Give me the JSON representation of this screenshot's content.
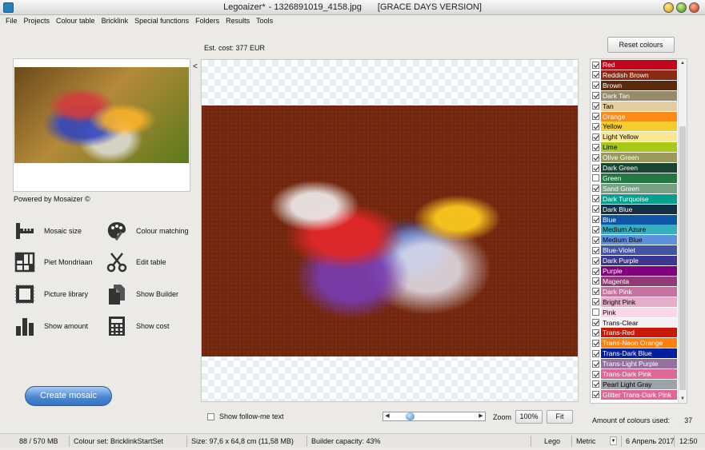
{
  "window": {
    "app_name": "Legoaizer*",
    "file_name": "- 1326891019_4158.jpg",
    "edition": "[GRACE DAYS VERSION]"
  },
  "menu": [
    "File",
    "Projects",
    "Colour table",
    "Bricklink",
    "Special functions",
    "Folders",
    "Results",
    "Tools"
  ],
  "left_panel": {
    "powered_by": "Powered by Mosaizer ©",
    "collapse_glyph": "<",
    "tools": [
      {
        "label": "Mosaic size",
        "icon": "ruler-icon"
      },
      {
        "label": "Colour matching",
        "icon": "palette-icon"
      },
      {
        "label": "Piet Mondriaan",
        "icon": "grid-icon"
      },
      {
        "label": "Edit table",
        "icon": "scissors-icon"
      },
      {
        "label": "Picture library",
        "icon": "picture-frame-icon"
      },
      {
        "label": "Show Builder",
        "icon": "documents-icon"
      },
      {
        "label": "Show amount",
        "icon": "bar-chart-icon"
      },
      {
        "label": "Show cost",
        "icon": "calculator-icon"
      }
    ],
    "create_button": "Create mosaic"
  },
  "center": {
    "est_cost": "Est. cost: 377 EUR",
    "follow_me_label": "Show follow-me text",
    "zoom_label": "Zoom",
    "zoom_value": "100%",
    "fit_label": "Fit",
    "slider_position": 0.18
  },
  "right_panel": {
    "reset_button": "Reset colours",
    "amount_label": "Amount of colours used:",
    "amount_value": "37",
    "colors": [
      {
        "name": "Red",
        "hex": "#c0061b",
        "text": "#ffffff",
        "checked": true
      },
      {
        "name": "Reddish Brown",
        "hex": "#8a2a12",
        "text": "#ffffff",
        "checked": true
      },
      {
        "name": "Brown",
        "hex": "#5a2a0e",
        "text": "#ffffff",
        "checked": true
      },
      {
        "name": "Dark Tan",
        "hex": "#958a6a",
        "text": "#ffffff",
        "checked": true
      },
      {
        "name": "Tan",
        "hex": "#e4cd9e",
        "text": "#000000",
        "checked": true
      },
      {
        "name": "Orange",
        "hex": "#fe8a18",
        "text": "#ffffff",
        "checked": true
      },
      {
        "name": "Yellow",
        "hex": "#f5cd2f",
        "text": "#000000",
        "checked": true
      },
      {
        "name": "Light Yellow",
        "hex": "#fbe696",
        "text": "#000000",
        "checked": true
      },
      {
        "name": "Lime",
        "hex": "#a5ca18",
        "text": "#000000",
        "checked": true
      },
      {
        "name": "Olive Green",
        "hex": "#9b9a5a",
        "text": "#ffffff",
        "checked": true
      },
      {
        "name": "Dark Green",
        "hex": "#184632",
        "text": "#ffffff",
        "checked": true
      },
      {
        "name": "Green",
        "hex": "#237841",
        "text": "#ffffff",
        "checked": false
      },
      {
        "name": "Sand Green",
        "hex": "#78a083",
        "text": "#ffffff",
        "checked": true
      },
      {
        "name": "Dark Turquoise",
        "hex": "#069e8e",
        "text": "#ffffff",
        "checked": true
      },
      {
        "name": "Dark Blue",
        "hex": "#143044",
        "text": "#ffffff",
        "checked": true
      },
      {
        "name": "Blue",
        "hex": "#0d56a6",
        "text": "#ffffff",
        "checked": true
      },
      {
        "name": "Medium Azure",
        "hex": "#36aebf",
        "text": "#000000",
        "checked": true
      },
      {
        "name": "Medium Blue",
        "hex": "#5a93db",
        "text": "#000000",
        "checked": true
      },
      {
        "name": "Blue-Violet",
        "hex": "#4354a3",
        "text": "#ffffff",
        "checked": true
      },
      {
        "name": "Dark Purple",
        "hex": "#3f3691",
        "text": "#ffffff",
        "checked": true
      },
      {
        "name": "Purple",
        "hex": "#81007b",
        "text": "#ffffff",
        "checked": true
      },
      {
        "name": "Magenta",
        "hex": "#923978",
        "text": "#ffffff",
        "checked": true
      },
      {
        "name": "Dark Pink",
        "hex": "#c870a0",
        "text": "#ffffff",
        "checked": true
      },
      {
        "name": "Bright Pink",
        "hex": "#e4adc8",
        "text": "#000000",
        "checked": true
      },
      {
        "name": "Pink",
        "hex": "#fcd7e8",
        "text": "#000000",
        "checked": false
      },
      {
        "name": "Trans-Clear",
        "hex": "#f2f2f2",
        "text": "#000000",
        "checked": true
      },
      {
        "name": "Trans-Red",
        "hex": "#c91a09",
        "text": "#ffffff",
        "checked": true
      },
      {
        "name": "Trans-Neon Orange",
        "hex": "#ff800d",
        "text": "#ffffff",
        "checked": true
      },
      {
        "name": "Trans-Dark Blue",
        "hex": "#0020a0",
        "text": "#ffffff",
        "checked": true
      },
      {
        "name": "Trans-Light Purple",
        "hex": "#96709f",
        "text": "#ffffff",
        "checked": true
      },
      {
        "name": "Trans-Dark Pink",
        "hex": "#df6695",
        "text": "#ffffff",
        "checked": true
      },
      {
        "name": "Pearl Light Gray",
        "hex": "#9ca3a8",
        "text": "#000000",
        "checked": true
      },
      {
        "name": "Glitter Trans-Dark Pink",
        "hex": "#df6695",
        "text": "#ffffff",
        "checked": true
      }
    ]
  },
  "status": {
    "memory": "88 / 570 MB",
    "colour_set": "Colour set: BricklinkStartSet",
    "size": "Size: 97,6 x 64,8 cm (11,58 MB)",
    "builder_capacity": "Builder capacity: 43%",
    "brand": "Lego",
    "unit": "Metric",
    "date": "6 Апрель 2017",
    "time": "12:50"
  }
}
